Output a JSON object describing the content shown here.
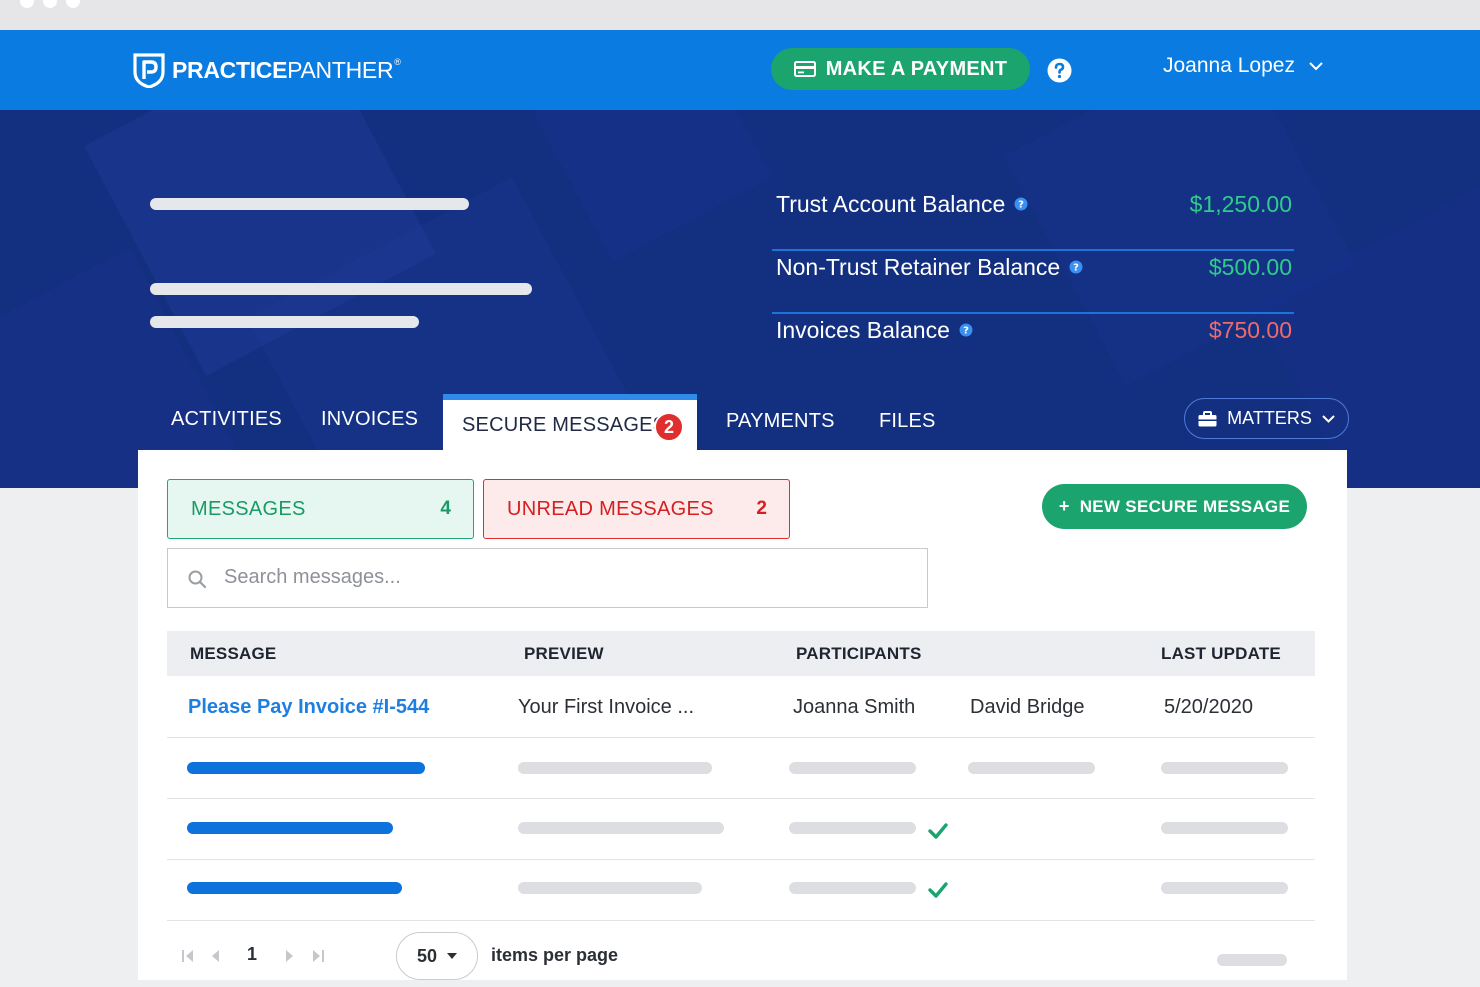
{
  "brand": {
    "name_bold": "PRACTICE",
    "name_light": "PANTHER",
    "registered": "®",
    "logo_icon": "panther-p-shield-icon"
  },
  "topbar": {
    "pay_button": "MAKE A PAYMENT",
    "help_icon": "question-circle-icon",
    "user_name": "Joanna Lopez"
  },
  "balances": [
    {
      "label": "Trust Account Balance",
      "value": "$1,250.00",
      "color": "#2ecc8a"
    },
    {
      "label": "Non-Trust Retainer Balance",
      "value": "$500.00",
      "color": "#2ecc8a"
    },
    {
      "label": "Invoices Balance",
      "value": "$750.00",
      "color": "#f06a6a"
    }
  ],
  "tabs": {
    "activities": "ACTIVITIES",
    "invoices": "INVOICES",
    "secure_messages": "SECURE MESSAGES",
    "secure_messages_badge": "2",
    "payments": "PAYMENTS",
    "files": "FILES"
  },
  "matters_button": "MATTERS",
  "filters": {
    "messages_label": "MESSAGES",
    "messages_count": "4",
    "unread_label": "UNREAD MESSAGES",
    "unread_count": "2"
  },
  "new_message_button": {
    "plus": "+",
    "label": "NEW SECURE MESSAGE"
  },
  "search": {
    "placeholder": "Search messages...",
    "value": ""
  },
  "table": {
    "headers": {
      "message": "MESSAGE",
      "preview": "PREVIEW",
      "participants": "PARTICIPANTS",
      "last_update": "LAST UPDATE"
    },
    "rows": [
      {
        "message": "Please Pay Invoice #I-544",
        "preview": "Your First Invoice ...",
        "participant_1": "Joanna Smith",
        "participant_2": "David Bridge",
        "last_update": "5/20/2020"
      }
    ]
  },
  "pager": {
    "page": "1",
    "per_page": "50",
    "per_page_label": "items per page"
  },
  "colors": {
    "topbar": "#0a7be0",
    "hero": "#132f80",
    "accent_green": "#1ba46e",
    "alert_red": "#e02d2d",
    "link_blue": "#1f7fe0"
  }
}
